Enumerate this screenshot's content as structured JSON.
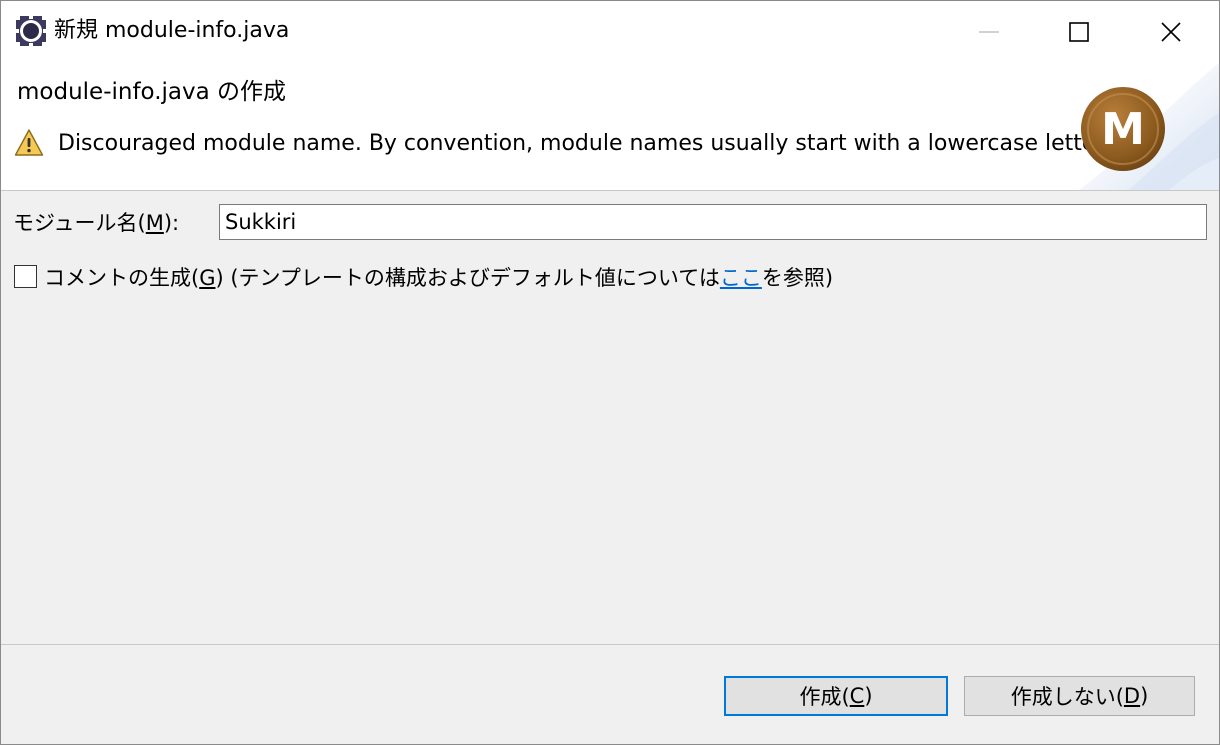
{
  "window": {
    "title": "新規 module-info.java",
    "icon": "eclipse-icon"
  },
  "banner": {
    "title": "module-info.java の作成",
    "warning_icon": "warning-triangle-icon",
    "warning": "Discouraged module name. By convention, module names usually start with a lowercase letter",
    "logo_icon": "module-m-icon",
    "logo_letter": "M",
    "accent": "#8b5a1e"
  },
  "form": {
    "module_label_pre": "モジュール名(",
    "module_label_key": "M",
    "module_label_post": "):",
    "module_value": "Sukkiri",
    "comment_checked": false,
    "comment_label_pre": "コメントの生成(",
    "comment_label_key": "G",
    "comment_label_mid": ") (テンプレートの構成およびデフォルト値については",
    "comment_link": "ここ",
    "comment_label_post": "を参照)"
  },
  "buttons": {
    "create_pre": "作成(",
    "create_key": "C",
    "create_post": ")",
    "no_create_pre": "作成しない(",
    "no_create_key": "D",
    "no_create_post": ")"
  },
  "colors": {
    "focus_border": "#0078d7",
    "link": "#0066cc"
  }
}
